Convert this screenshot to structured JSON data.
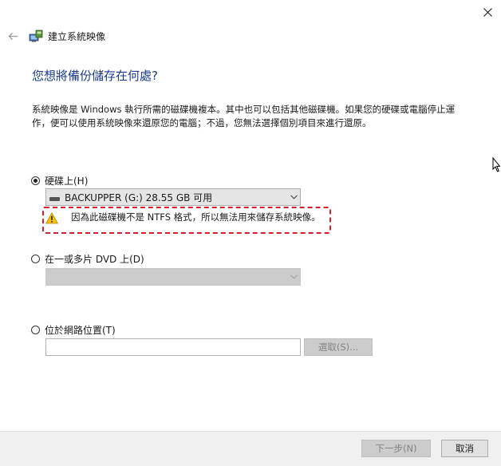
{
  "window": {
    "title": "建立系統映像"
  },
  "page": {
    "heading": "您想將備份儲存在何處?",
    "description": "系統映像是 Windows 執行所需的磁碟機複本。其中也可以包括其他磁碟機。如果您的硬碟或電腦停止運作，便可以使用系統映像來還原您的電腦；不過，您無法選擇個別項目來進行還原。"
  },
  "options": {
    "hard_disk": {
      "label": "硬碟上(H)",
      "selected": true,
      "drive_value": "BACKUPPER (G:)  28.55 GB 可用",
      "warning": "因為此磁碟機不是 NTFS 格式，所以無法用來儲存系統映像。",
      "warning_highlight_color": "#d4202c"
    },
    "dvd": {
      "label": "在一或多片 DVD 上(D)",
      "selected": false,
      "drive_value": ""
    },
    "network": {
      "label": "位於網路位置(T)",
      "selected": false,
      "path_value": "",
      "browse_label": "選取(S)..."
    }
  },
  "footer": {
    "next_label": "下一步(N)",
    "cancel_label": "取消"
  },
  "colors": {
    "heading": "#1a3b8c",
    "disabled_bg": "#cccccc",
    "footer_bg": "#f0f0f0"
  }
}
